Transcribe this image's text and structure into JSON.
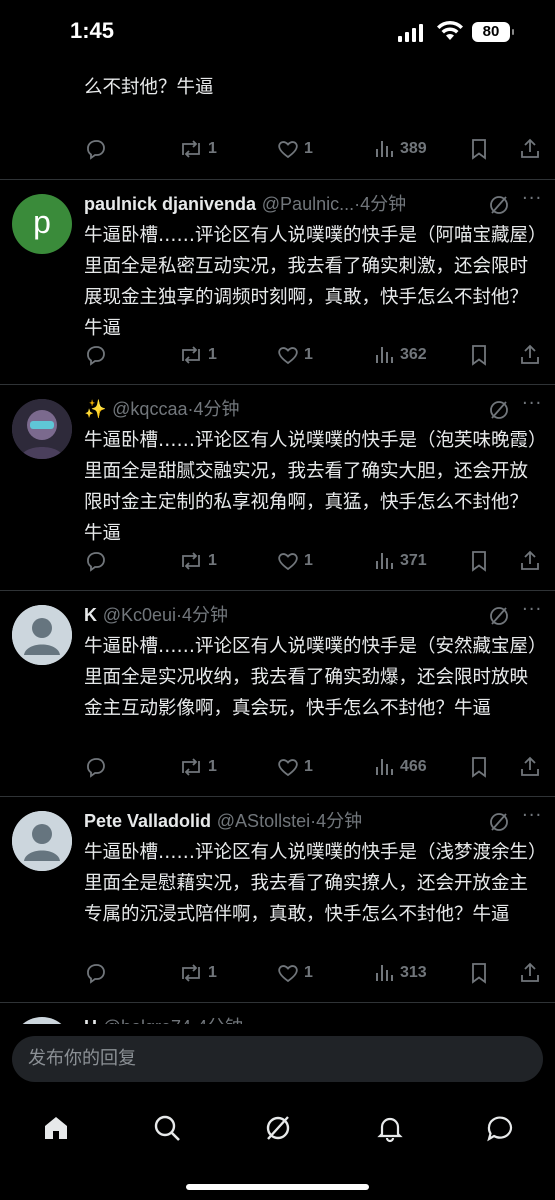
{
  "status": {
    "time": "1:45",
    "battery": "80"
  },
  "partial_top": {
    "text": "还会不定时展演金主点映的缠斗戏码啊，真会，快手怎么不封他？牛逼"
  },
  "partial_top_actions": {
    "replies": "",
    "reposts": "1",
    "likes": "1",
    "views": "389"
  },
  "tweets": [
    {
      "name": "paulnick djanivenda",
      "handle": "@Paulnic...",
      "time": "·4分钟",
      "avatar_letter": "p",
      "avatar_color": "#3a8b3a",
      "text": "牛逼卧槽……评论区有人说噗噗的快手是（阿喵宝藏屋）里面全是私密互动实况，我去看了确实刺激，还会限时展现金主独享的调频时刻啊，真敢，快手怎么不封他？牛逼",
      "reposts": "1",
      "likes": "1",
      "views": "362"
    },
    {
      "name": "✨",
      "handle": "@kqccaa",
      "time": "·4分钟",
      "avatar_letter": "",
      "avatar_color": "#6a5e7e",
      "text": "牛逼卧槽……评论区有人说噗噗的快手是（泡芙味晚霞）里面全是甜腻交融实况，我去看了确实大胆，还会开放限时金主定制的私享视角啊，真猛，快手怎么不封他？牛逼",
      "reposts": "1",
      "likes": "1",
      "views": "371"
    },
    {
      "name": "K",
      "handle": "@Kc0eui",
      "time": "·4分钟",
      "avatar_letter": "",
      "avatar_color": "#ccd6dd",
      "text": "牛逼卧槽……评论区有人说噗噗的快手是（安然藏宝屋）里面全是实况收纳，我去看了确实劲爆，还会限时放映金主互动影像啊，真会玩，快手怎么不封他？牛逼",
      "reposts": "1",
      "likes": "1",
      "views": "466"
    },
    {
      "name": "Pete Valladolid",
      "handle": "@AStollstei",
      "time": "·4分钟",
      "avatar_letter": "",
      "avatar_color": "#ccd6dd",
      "text": "牛逼卧槽……评论区有人说噗噗的快手是（浅梦渡余生）里面全是慰藉实况，我去看了确实撩人，还会开放金主专属的沉浸式陪伴啊，真敢，快手怎么不封他？牛逼",
      "reposts": "1",
      "likes": "1",
      "views": "313"
    }
  ],
  "partial_bottom": {
    "name": "H",
    "handle": "@holgre74",
    "time": "·4分钟"
  },
  "reply": {
    "placeholder": "发布你的回复"
  },
  "nav": {
    "items": [
      "home-icon",
      "search-icon",
      "grok-icon",
      "notifications-icon",
      "messages-icon"
    ]
  }
}
